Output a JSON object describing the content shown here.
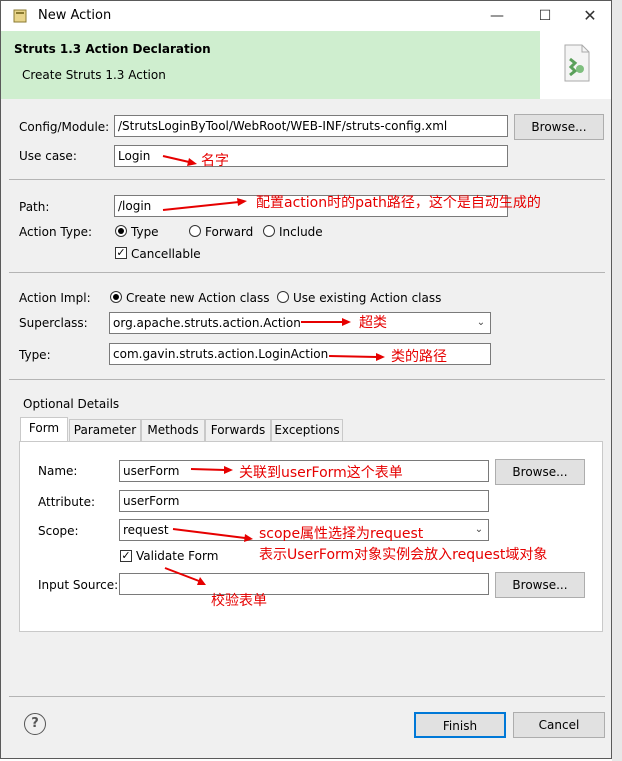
{
  "window": {
    "title": "New Action",
    "header_title": "Struts 1.3 Action Declaration",
    "header_subtitle": "Create Struts 1.3 Action"
  },
  "config": {
    "config_label": "Config/Module:",
    "config_value": "/StrutsLoginByTool/WebRoot/WEB-INF/struts-config.xml",
    "browse_label": "Browse...",
    "usecase_label": "Use case:",
    "usecase_value": "Login"
  },
  "path": {
    "path_label": "Path:",
    "path_value": "/login",
    "type_label": "Action Type:",
    "type_options": [
      "Type",
      "Forward",
      "Include"
    ],
    "type_selected": "Type",
    "cancellable_label": "Cancellable",
    "cancellable_checked": true
  },
  "impl": {
    "impl_label": "Action Impl:",
    "options": [
      "Create new Action class",
      "Use existing Action class"
    ],
    "selected": "Create new Action class",
    "superclass_label": "Superclass:",
    "superclass_value": "org.apache.struts.action.Action",
    "type_label": "Type:",
    "type_value": "com.gavin.struts.action.LoginAction"
  },
  "optional": {
    "title": "Optional Details",
    "tabs": [
      "Form",
      "Parameter",
      "Methods",
      "Forwards",
      "Exceptions"
    ],
    "active_tab": "Form",
    "name_label": "Name:",
    "name_value": "userForm",
    "name_browse": "Browse...",
    "attribute_label": "Attribute:",
    "attribute_value": "userForm",
    "scope_label": "Scope:",
    "scope_value": "request",
    "validate_label": "Validate Form",
    "validate_checked": true,
    "input_label": "Input Source:",
    "input_value": "",
    "input_browse": "Browse..."
  },
  "footer": {
    "help": "?",
    "finish": "Finish",
    "cancel": "Cancel"
  },
  "annotations": {
    "name_note": "名字",
    "path_note": "配置action时的path路径，这个是自动生成的",
    "superclass_note": "超类",
    "type_note": "类的路径",
    "userform_note": "关联到userForm这个表单",
    "scope_note1": "scope属性选择为request",
    "scope_note2": "表示UserForm对象实例会放入request域对象",
    "validate_note": "校验表单"
  },
  "colors": {
    "header_bg": "#cfeecf",
    "annotation": "#e60000",
    "window_bg": "#f0f0f0"
  }
}
